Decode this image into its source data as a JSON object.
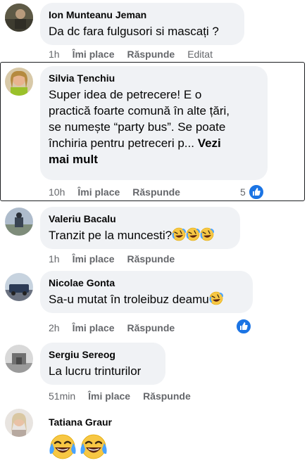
{
  "comments": [
    {
      "author": "Ion Munteanu Jeman",
      "text": "Da dc fara fulgusori si mascați ?",
      "time": "1h",
      "like": "Îmi place",
      "reply": "Răspunde",
      "edited": "Editat"
    },
    {
      "author": "Silvia Țenchiu",
      "text_lines": [
        "Super idea de petrecere! E o",
        "practică foarte comună în alte țări,",
        "se numește “party bus”. Se poate",
        "închiria pentru petreceri p..."
      ],
      "see_more": "Vezi",
      "see_more_2": "mai mult",
      "time": "10h",
      "like": "Îmi place",
      "reply": "Răspunde",
      "reactions": "5"
    },
    {
      "author": "Valeriu Bacalu",
      "text": "Tranzit pe la muncesti?",
      "time": "1h",
      "like": "Îmi place",
      "reply": "Răspunde"
    },
    {
      "author": "Nicolae Gonta",
      "text": "Sa-u mutat în troleibuz deamu",
      "time": "2h",
      "like": "Îmi place",
      "reply": "Răspunde"
    },
    {
      "author": "Sergiu Sereog",
      "text": "La lucru trinturilor",
      "time": "51min",
      "like": "Îmi place",
      "reply": "Răspunde"
    },
    {
      "author": "Tatiana Graur"
    }
  ],
  "icons": {
    "like": "thumbs-up-icon",
    "laugh": "rolling-on-floor-laughing-emoji",
    "tears": "tears-of-joy-emoji"
  },
  "colors": {
    "bubble": "#f0f2f5",
    "meta": "#65676b",
    "accent": "#1b74e4"
  }
}
